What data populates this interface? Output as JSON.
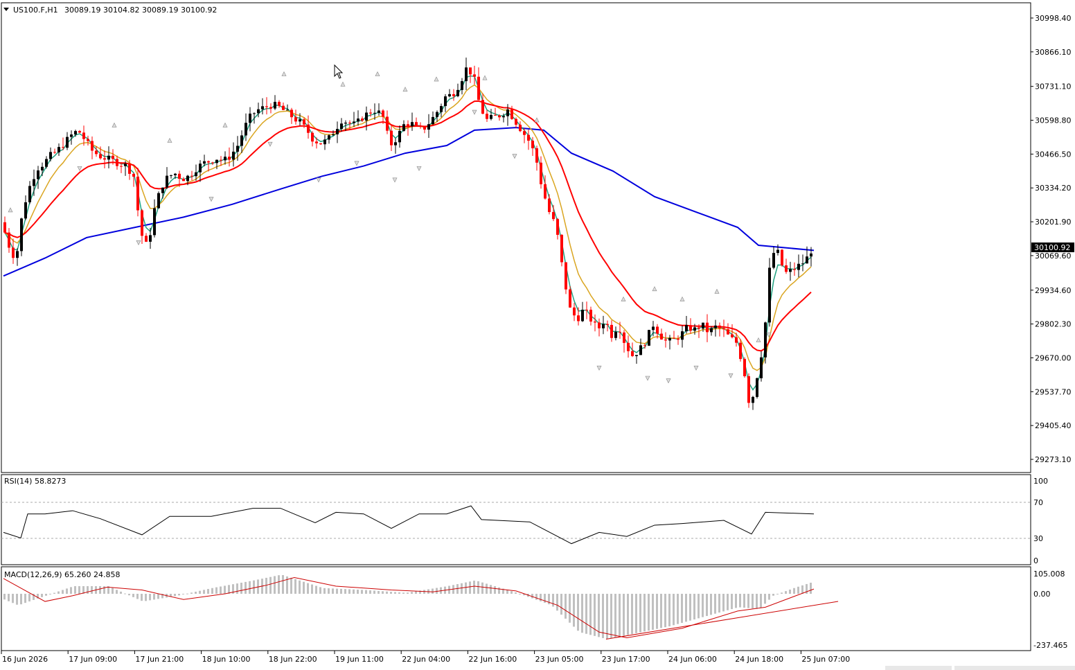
{
  "header": {
    "symbol": "US100.F,H1",
    "ohlc": "30089.19 30104.82 30089.19 30100.92",
    "dropdown_icon": "triangle-down-icon"
  },
  "price_axis": {
    "ticks": [
      "30998.40",
      "30866.10",
      "30731.10",
      "30598.80",
      "30466.50",
      "30334.20",
      "30201.90",
      "30069.60",
      "29934.60",
      "29802.30",
      "29670.00",
      "29537.70",
      "29405.40",
      "29273.10"
    ],
    "current_price": "30100.92"
  },
  "time_axis": {
    "labels": [
      "16 Jun 2026",
      "17 Jun 09:00",
      "17 Jun 21:00",
      "18 Jun 10:00",
      "18 Jun 22:00",
      "19 Jun 11:00",
      "22 Jun 04:00",
      "22 Jun 16:00",
      "23 Jun 05:00",
      "23 Jun 17:00",
      "24 Jun 06:00",
      "24 Jun 18:00",
      "25 Jun 07:00"
    ]
  },
  "rsi": {
    "title": "RSI(14) 58.8273",
    "levels": [
      "100",
      "70",
      "30",
      "0"
    ]
  },
  "macd": {
    "title": "MACD(12,26,9) 65.260 24.858",
    "levels": [
      "105.008",
      "0.00",
      "-237.465"
    ]
  },
  "colors": {
    "bull_candle": "#000000",
    "bear_candle": "#ff0000",
    "ma_fast": "#20a080",
    "ma_mid": "#daa520",
    "ma_slow": "#ff0000",
    "ma_200": "#0000dd",
    "price_box_bg": "#000000"
  },
  "chart_data": {
    "type": "candlestick",
    "x_range": [
      "16 Jun 2026",
      "25 Jun 07:00"
    ],
    "price_path": [
      [
        0,
        30200
      ],
      [
        8,
        30120
      ],
      [
        20,
        30050
      ],
      [
        30,
        30250
      ],
      [
        40,
        30340
      ],
      [
        50,
        30410
      ],
      [
        60,
        30430
      ],
      [
        70,
        30460
      ],
      [
        80,
        30480
      ],
      [
        90,
        30510
      ],
      [
        100,
        30540
      ],
      [
        110,
        30560
      ],
      [
        120,
        30520
      ],
      [
        130,
        30480
      ],
      [
        140,
        30460
      ],
      [
        150,
        30450
      ],
      [
        160,
        30440
      ],
      [
        170,
        30430
      ],
      [
        180,
        30420
      ],
      [
        190,
        30380
      ],
      [
        200,
        30160
      ],
      [
        210,
        30100
      ],
      [
        220,
        30250
      ],
      [
        230,
        30340
      ],
      [
        240,
        30380
      ],
      [
        250,
        30390
      ],
      [
        260,
        30370
      ],
      [
        270,
        30380
      ],
      [
        280,
        30410
      ],
      [
        290,
        30430
      ],
      [
        300,
        30440
      ],
      [
        310,
        30450
      ],
      [
        320,
        30440
      ],
      [
        330,
        30460
      ],
      [
        340,
        30500
      ],
      [
        350,
        30570
      ],
      [
        360,
        30620
      ],
      [
        370,
        30640
      ],
      [
        380,
        30650
      ],
      [
        390,
        30660
      ],
      [
        400,
        30650
      ],
      [
        410,
        30630
      ],
      [
        420,
        30610
      ],
      [
        430,
        30590
      ],
      [
        440,
        30560
      ],
      [
        450,
        30520
      ],
      [
        460,
        30510
      ],
      [
        470,
        30520
      ],
      [
        480,
        30560
      ],
      [
        490,
        30600
      ],
      [
        500,
        30590
      ],
      [
        510,
        30580
      ],
      [
        520,
        30610
      ],
      [
        530,
        30630
      ],
      [
        540,
        30640
      ],
      [
        550,
        30610
      ],
      [
        560,
        30500
      ],
      [
        570,
        30530
      ],
      [
        580,
        30580
      ],
      [
        590,
        30590
      ],
      [
        600,
        30560
      ],
      [
        610,
        30570
      ],
      [
        620,
        30600
      ],
      [
        630,
        30640
      ],
      [
        640,
        30690
      ],
      [
        650,
        30700
      ],
      [
        660,
        30740
      ],
      [
        670,
        30800
      ],
      [
        680,
        30780
      ],
      [
        690,
        30650
      ],
      [
        700,
        30600
      ],
      [
        710,
        30610
      ],
      [
        720,
        30620
      ],
      [
        730,
        30640
      ],
      [
        740,
        30600
      ],
      [
        750,
        30560
      ],
      [
        760,
        30520
      ],
      [
        770,
        30460
      ],
      [
        780,
        30330
      ],
      [
        790,
        30240
      ],
      [
        800,
        30180
      ],
      [
        810,
        30000
      ],
      [
        820,
        29860
      ],
      [
        830,
        29820
      ],
      [
        840,
        29860
      ],
      [
        850,
        29820
      ],
      [
        860,
        29780
      ],
      [
        870,
        29820
      ],
      [
        880,
        29760
      ],
      [
        890,
        29800
      ],
      [
        900,
        29720
      ],
      [
        910,
        29680
      ],
      [
        920,
        29700
      ],
      [
        930,
        29740
      ],
      [
        940,
        29800
      ],
      [
        950,
        29760
      ],
      [
        960,
        29730
      ],
      [
        970,
        29740
      ],
      [
        980,
        29760
      ],
      [
        990,
        29790
      ],
      [
        1000,
        29780
      ],
      [
        1010,
        29800
      ],
      [
        1020,
        29770
      ],
      [
        1030,
        29790
      ],
      [
        1040,
        29780
      ],
      [
        1050,
        29750
      ],
      [
        1060,
        29730
      ],
      [
        1070,
        29640
      ],
      [
        1080,
        29470
      ],
      [
        1090,
        29600
      ],
      [
        1100,
        29740
      ],
      [
        1110,
        30080
      ],
      [
        1120,
        30080
      ],
      [
        1130,
        30000
      ],
      [
        1140,
        30010
      ],
      [
        1150,
        30030
      ],
      [
        1160,
        30050
      ],
      [
        1170,
        30100
      ]
    ],
    "ma_200_path": [
      [
        0,
        29990
      ],
      [
        60,
        30060
      ],
      [
        120,
        30140
      ],
      [
        190,
        30180
      ],
      [
        260,
        30220
      ],
      [
        330,
        30270
      ],
      [
        400,
        30330
      ],
      [
        460,
        30380
      ],
      [
        520,
        30420
      ],
      [
        580,
        30470
      ],
      [
        640,
        30500
      ],
      [
        680,
        30560
      ],
      [
        740,
        30570
      ],
      [
        780,
        30560
      ],
      [
        820,
        30470
      ],
      [
        880,
        30400
      ],
      [
        940,
        30300
      ],
      [
        1000,
        30240
      ],
      [
        1060,
        30180
      ],
      [
        1090,
        30110
      ],
      [
        1170,
        30090
      ]
    ],
    "rsi_path": [
      [
        0,
        35
      ],
      [
        25,
        28
      ],
      [
        35,
        58
      ],
      [
        60,
        58
      ],
      [
        100,
        62
      ],
      [
        140,
        52
      ],
      [
        200,
        32
      ],
      [
        240,
        55
      ],
      [
        300,
        55
      ],
      [
        360,
        65
      ],
      [
        400,
        65
      ],
      [
        450,
        47
      ],
      [
        480,
        60
      ],
      [
        520,
        58
      ],
      [
        560,
        40
      ],
      [
        600,
        58
      ],
      [
        640,
        58
      ],
      [
        675,
        68
      ],
      [
        690,
        51
      ],
      [
        760,
        48
      ],
      [
        820,
        21
      ],
      [
        860,
        35
      ],
      [
        900,
        30
      ],
      [
        940,
        44
      ],
      [
        980,
        46
      ],
      [
        1040,
        50
      ],
      [
        1080,
        33
      ],
      [
        1100,
        60
      ],
      [
        1170,
        58
      ]
    ],
    "macd_hist": [
      [
        0,
        -30
      ],
      [
        20,
        -60
      ],
      [
        60,
        -10
      ],
      [
        100,
        40
      ],
      [
        150,
        40
      ],
      [
        200,
        -40
      ],
      [
        250,
        -10
      ],
      [
        300,
        30
      ],
      [
        360,
        70
      ],
      [
        400,
        100
      ],
      [
        460,
        30
      ],
      [
        520,
        20
      ],
      [
        580,
        5
      ],
      [
        640,
        40
      ],
      [
        680,
        70
      ],
      [
        740,
        5
      ],
      [
        790,
        -60
      ],
      [
        830,
        -200
      ],
      [
        870,
        -237
      ],
      [
        920,
        -200
      ],
      [
        960,
        -170
      ],
      [
        1000,
        -130
      ],
      [
        1060,
        -70
      ],
      [
        1090,
        -80
      ],
      [
        1110,
        -10
      ],
      [
        1140,
        30
      ],
      [
        1170,
        65
      ]
    ],
    "macd_signal": [
      [
        0,
        80
      ],
      [
        60,
        -40
      ],
      [
        100,
        -10
      ],
      [
        150,
        35
      ],
      [
        200,
        20
      ],
      [
        260,
        -30
      ],
      [
        320,
        0
      ],
      [
        380,
        45
      ],
      [
        420,
        85
      ],
      [
        480,
        40
      ],
      [
        560,
        20
      ],
      [
        620,
        10
      ],
      [
        680,
        40
      ],
      [
        740,
        15
      ],
      [
        800,
        -60
      ],
      [
        860,
        -200
      ],
      [
        900,
        -230
      ],
      [
        980,
        -180
      ],
      [
        1060,
        -90
      ],
      [
        1100,
        -70
      ],
      [
        1170,
        25
      ]
    ],
    "ylim": [
      29200,
      31050
    ]
  }
}
